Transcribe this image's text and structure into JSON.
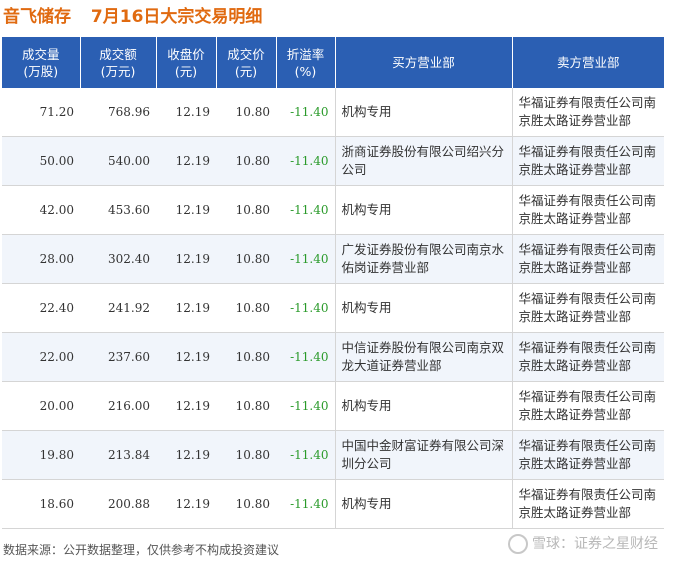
{
  "title": {
    "stock": "音飞储存",
    "subtitle": "7月16日大宗交易明细"
  },
  "table": {
    "headers": [
      {
        "l1": "成交量",
        "l2": "(万股)"
      },
      {
        "l1": "成交额",
        "l2": "(万元)"
      },
      {
        "l1": "收盘价",
        "l2": "(元)"
      },
      {
        "l1": "成交价",
        "l2": "(元)"
      },
      {
        "l1": "折溢率",
        "l2": "(%)"
      },
      {
        "l1": "买方营业部",
        "l2": ""
      },
      {
        "l1": "卖方营业部",
        "l2": ""
      }
    ],
    "rows": [
      {
        "volume": "71.20",
        "amount": "768.96",
        "close": "12.19",
        "price": "10.80",
        "premium": "-11.40",
        "buyer": "机构专用",
        "seller": "华福证券有限责任公司南京胜太路证券营业部"
      },
      {
        "volume": "50.00",
        "amount": "540.00",
        "close": "12.19",
        "price": "10.80",
        "premium": "-11.40",
        "buyer": "浙商证券股份有限公司绍兴分公司",
        "seller": "华福证券有限责任公司南京胜太路证券营业部"
      },
      {
        "volume": "42.00",
        "amount": "453.60",
        "close": "12.19",
        "price": "10.80",
        "premium": "-11.40",
        "buyer": "机构专用",
        "seller": "华福证券有限责任公司南京胜太路证券营业部"
      },
      {
        "volume": "28.00",
        "amount": "302.40",
        "close": "12.19",
        "price": "10.80",
        "premium": "-11.40",
        "buyer": "广发证券股份有限公司南京水佑岗证券营业部",
        "seller": "华福证券有限责任公司南京胜太路证券营业部"
      },
      {
        "volume": "22.40",
        "amount": "241.92",
        "close": "12.19",
        "price": "10.80",
        "premium": "-11.40",
        "buyer": "机构专用",
        "seller": "华福证券有限责任公司南京胜太路证券营业部"
      },
      {
        "volume": "22.00",
        "amount": "237.60",
        "close": "12.19",
        "price": "10.80",
        "premium": "-11.40",
        "buyer": "中信证券股份有限公司南京双龙大道证券营业部",
        "seller": "华福证券有限责任公司南京胜太路证券营业部"
      },
      {
        "volume": "20.00",
        "amount": "216.00",
        "close": "12.19",
        "price": "10.80",
        "premium": "-11.40",
        "buyer": "机构专用",
        "seller": "华福证券有限责任公司南京胜太路证券营业部"
      },
      {
        "volume": "19.80",
        "amount": "213.84",
        "close": "12.19",
        "price": "10.80",
        "premium": "-11.40",
        "buyer": "中国中金财富证券有限公司深圳分公司",
        "seller": "华福证券有限责任公司南京胜太路证券营业部"
      },
      {
        "volume": "18.60",
        "amount": "200.88",
        "close": "12.19",
        "price": "10.80",
        "premium": "-11.40",
        "buyer": "机构专用",
        "seller": "华福证券有限责任公司南京胜太路证券营业部"
      }
    ]
  },
  "footer": {
    "source": "数据来源：公开数据整理，仅供参考不构成投资建议"
  },
  "brand": {
    "text": "雪球：证券之星财经"
  },
  "colors": {
    "header_bg": "#2b5fb3",
    "title": "#e06a10",
    "negative": "#2a9a2a",
    "row_alt": "#f1f5fb"
  }
}
